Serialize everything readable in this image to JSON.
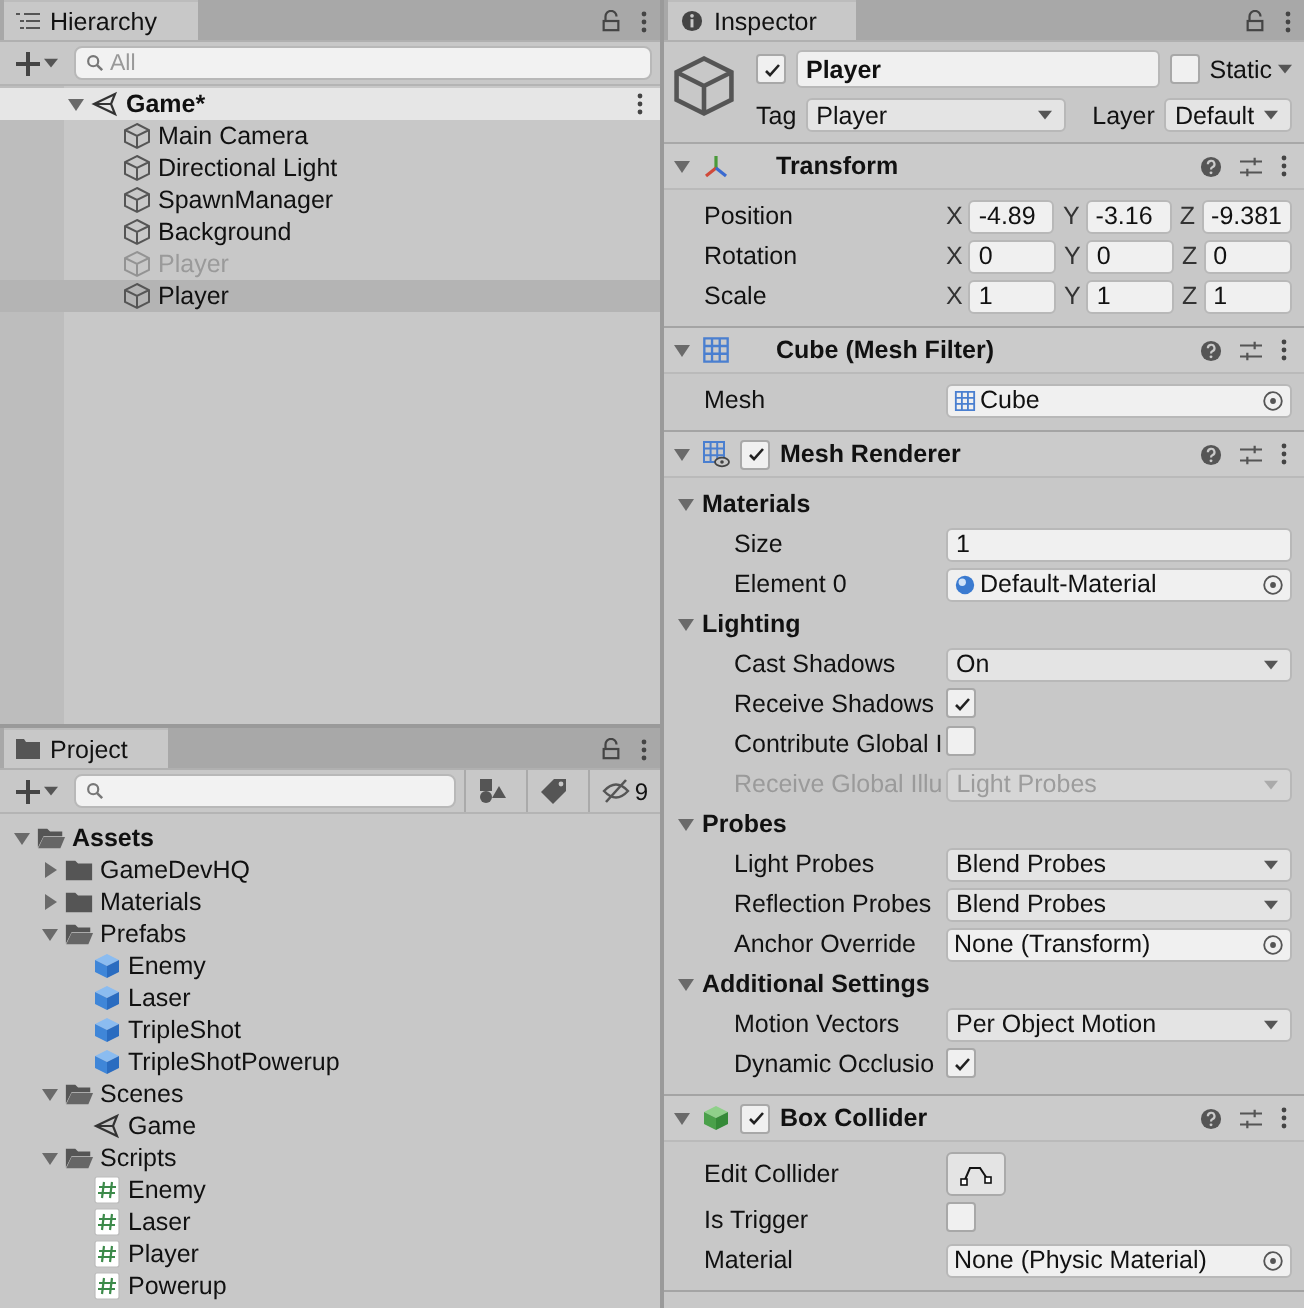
{
  "hierarchy": {
    "title": "Hierarchy",
    "search": {
      "placeholder": "All"
    },
    "scene": {
      "name": "Game*",
      "expanded": true,
      "children": [
        {
          "name": "Main Camera",
          "active": true,
          "selected": false
        },
        {
          "name": "Directional Light",
          "active": true,
          "selected": false
        },
        {
          "name": "SpawnManager",
          "active": true,
          "selected": false
        },
        {
          "name": "Background",
          "active": true,
          "selected": false
        },
        {
          "name": "Player",
          "active": false,
          "selected": false
        },
        {
          "name": "Player",
          "active": true,
          "selected": true
        }
      ]
    }
  },
  "project": {
    "title": "Project",
    "hidden_count": "9",
    "tree": [
      {
        "name": "Assets",
        "kind": "folder",
        "expanded": true,
        "children": [
          {
            "name": "GameDevHQ",
            "kind": "folder",
            "expanded": false
          },
          {
            "name": "Materials",
            "kind": "folder",
            "expanded": false
          },
          {
            "name": "Prefabs",
            "kind": "folder",
            "expanded": true,
            "children": [
              {
                "name": "Enemy",
                "kind": "prefab"
              },
              {
                "name": "Laser",
                "kind": "prefab"
              },
              {
                "name": "TripleShot",
                "kind": "prefab"
              },
              {
                "name": "TripleShotPowerup",
                "kind": "prefab"
              }
            ]
          },
          {
            "name": "Scenes",
            "kind": "folder",
            "expanded": true,
            "children": [
              {
                "name": "Game",
                "kind": "scene"
              }
            ]
          },
          {
            "name": "Scripts",
            "kind": "folder",
            "expanded": true,
            "children": [
              {
                "name": "Enemy",
                "kind": "script"
              },
              {
                "name": "Laser",
                "kind": "script"
              },
              {
                "name": "Player",
                "kind": "script"
              },
              {
                "name": "Powerup",
                "kind": "script"
              }
            ]
          }
        ]
      }
    ]
  },
  "inspector": {
    "title": "Inspector",
    "object": {
      "active": true,
      "name": "Player",
      "static": false,
      "static_label": "Static",
      "tag_label": "Tag",
      "tag": "Player",
      "layer_label": "Layer",
      "layer": "Default"
    },
    "components": [
      {
        "kind": "transform",
        "title": "Transform",
        "expanded": true,
        "rows": [
          {
            "kind": "vector3",
            "label": "Position",
            "axes": [
              {
                "axis": "X",
                "value": "-4.89"
              },
              {
                "axis": "Y",
                "value": "-3.16"
              },
              {
                "axis": "Z",
                "value": "-9.381"
              }
            ]
          },
          {
            "kind": "vector3",
            "label": "Rotation",
            "axes": [
              {
                "axis": "X",
                "value": "0"
              },
              {
                "axis": "Y",
                "value": "0"
              },
              {
                "axis": "Z",
                "value": "0"
              }
            ]
          },
          {
            "kind": "vector3",
            "label": "Scale",
            "axes": [
              {
                "axis": "X",
                "value": "1"
              },
              {
                "axis": "Y",
                "value": "1"
              },
              {
                "axis": "Z",
                "value": "1"
              }
            ]
          }
        ]
      },
      {
        "kind": "mesh_filter",
        "title": "Cube (Mesh Filter)",
        "expanded": true,
        "rows": [
          {
            "kind": "mesh_object",
            "label": "Mesh",
            "value": "Cube"
          }
        ]
      },
      {
        "kind": "mesh_renderer",
        "title": "Mesh Renderer",
        "enabled": true,
        "expanded": true,
        "rows": [
          {
            "kind": "section",
            "label": "Materials",
            "expanded": true,
            "children": [
              {
                "kind": "text",
                "label": "Size",
                "value": "1"
              },
              {
                "kind": "material_object",
                "label": "Element 0",
                "value": "Default-Material"
              }
            ]
          },
          {
            "kind": "section",
            "label": "Lighting",
            "expanded": true,
            "children": [
              {
                "kind": "dropdown",
                "label": "Cast Shadows",
                "value": "On",
                "disabled": false
              },
              {
                "kind": "checkbox",
                "label": "Receive Shadows",
                "checked": true
              },
              {
                "kind": "checkbox",
                "label": "Contribute Global I",
                "checked": false
              },
              {
                "kind": "dropdown",
                "label": "Receive Global Illu",
                "value": "Light Probes",
                "disabled": true
              }
            ]
          },
          {
            "kind": "section",
            "label": "Probes",
            "expanded": true,
            "children": [
              {
                "kind": "dropdown",
                "label": "Light Probes",
                "value": "Blend Probes",
                "disabled": false
              },
              {
                "kind": "dropdown",
                "label": "Reflection Probes",
                "value": "Blend Probes",
                "disabled": false
              },
              {
                "kind": "object",
                "label": "Anchor Override",
                "value": "None (Transform)"
              }
            ]
          },
          {
            "kind": "section",
            "label": "Additional Settings",
            "expanded": true,
            "children": [
              {
                "kind": "dropdown",
                "label": "Motion Vectors",
                "value": "Per Object Motion",
                "disabled": false
              },
              {
                "kind": "checkbox",
                "label": "Dynamic Occlusio",
                "checked": true
              }
            ]
          }
        ]
      },
      {
        "kind": "box_collider",
        "title": "Box Collider",
        "enabled": true,
        "expanded": true,
        "rows": [
          {
            "kind": "button",
            "label": "Edit Collider"
          },
          {
            "kind": "checkbox",
            "label": "Is Trigger",
            "checked": false
          },
          {
            "kind": "object",
            "label": "Material",
            "value": "None (Physic Material)"
          }
        ]
      }
    ]
  }
}
